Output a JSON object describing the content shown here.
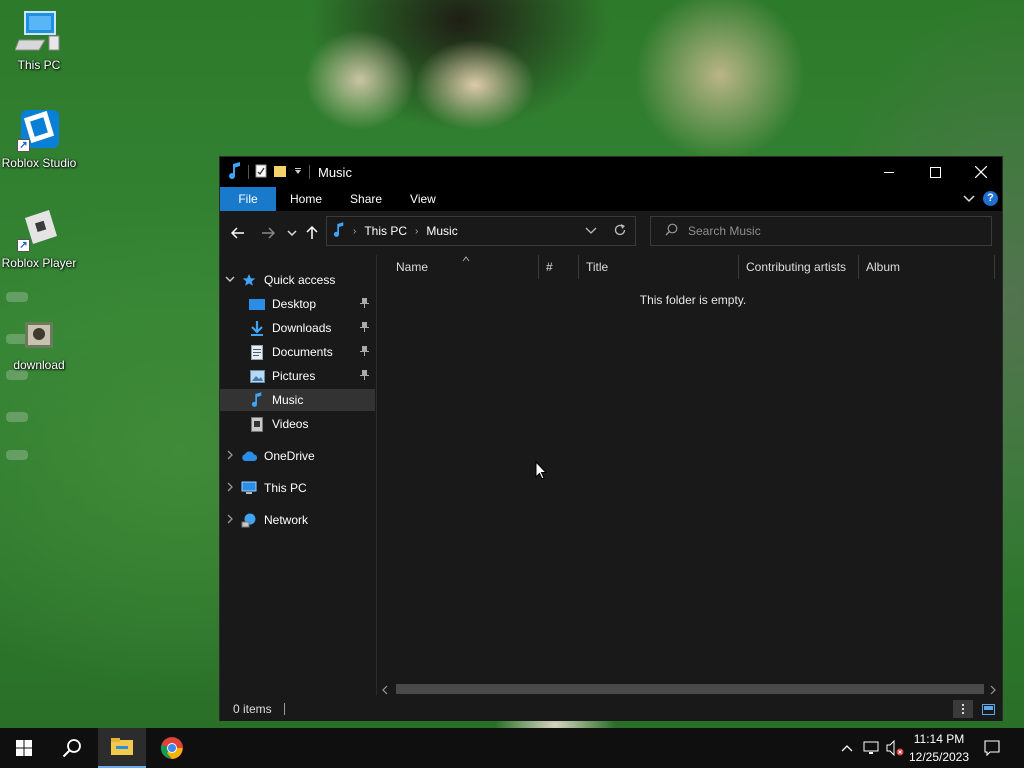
{
  "desktop": {
    "icons": [
      {
        "label": "This PC",
        "icon": "this-pc-icon"
      },
      {
        "label": "Roblox Studio",
        "icon": "roblox-studio-icon"
      },
      {
        "label": "Roblox Player",
        "icon": "roblox-player-icon"
      },
      {
        "label": "download",
        "icon": "image-file-icon"
      }
    ]
  },
  "window": {
    "title": "Music",
    "controls": {
      "minimize": "—",
      "maximize": "☐",
      "close": "✕"
    },
    "ribbon_tabs": [
      "File",
      "Home",
      "Share",
      "View"
    ],
    "breadcrumb": [
      "This PC",
      "Music"
    ],
    "search_placeholder": "Search Music",
    "nav_pane": {
      "quick_access": "Quick access",
      "quick_items": [
        {
          "label": "Desktop",
          "pinned": true
        },
        {
          "label": "Downloads",
          "pinned": true
        },
        {
          "label": "Documents",
          "pinned": true
        },
        {
          "label": "Pictures",
          "pinned": true
        },
        {
          "label": "Music",
          "pinned": false,
          "selected": true
        },
        {
          "label": "Videos",
          "pinned": false
        }
      ],
      "roots": [
        "OneDrive",
        "This PC",
        "Network"
      ]
    },
    "columns": [
      "Name",
      "#",
      "Title",
      "Contributing artists",
      "Album"
    ],
    "empty_message": "This folder is empty.",
    "status": "0 items"
  },
  "taskbar": {
    "apps": [
      "start-icon",
      "search-icon",
      "file-explorer-icon",
      "chrome-icon"
    ],
    "time": "11:14 PM",
    "date": "12/25/2023"
  },
  "colors": {
    "accent": "#1979ca",
    "window_bg": "#191919",
    "titlebar_bg": "#000000"
  }
}
